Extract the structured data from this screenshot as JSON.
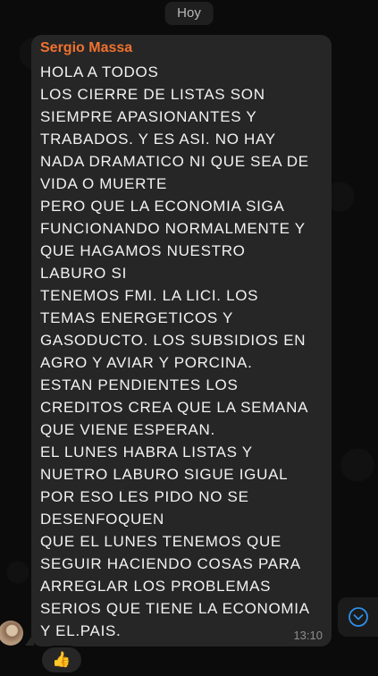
{
  "date_divider": "Hoy",
  "message": {
    "sender": "Sergio Massa",
    "lines": [
      "HOLA A TODOS",
      "LOS CIERRE DE LISTAS SON",
      "SIEMPRE APASIONANTES Y",
      "TRABADOS. Y ES ASI. NO HAY",
      "NADA DRAMATICO NI QUE SEA DE",
      "VIDA O MUERTE",
      "PERO QUE LA ECONOMIA SIGA",
      "FUNCIONANDO NORMALMENTE Y",
      "QUE HAGAMOS NUESTRO",
      "LABURO SI",
      "TENEMOS FMI. LA LICI. LOS",
      "TEMAS ENERGETICOS Y",
      "GASODUCTO. LOS SUBSIDIOS EN",
      "AGRO Y AVIAR Y PORCINA.",
      "ESTAN PENDIENTES LOS",
      "CREDITOS CREA QUE LA SEMANA",
      "QUE VIENE ESPERAN.",
      "EL LUNES HABRA LISTAS Y",
      "NUETRO LABURO SIGUE IGUAL",
      "POR ESO LES PIDO NO SE",
      "DESENFOQUEN",
      "QUE EL LUNES TENEMOS QUE",
      "SEGUIR HACIENDO COSAS PARA",
      "ARREGLAR LOS PROBLEMAS",
      "SERIOS QUE TIENE LA ECONOMIA",
      "Y EL.PAIS."
    ],
    "time": "13:10",
    "reaction": "👍"
  },
  "icons": {
    "scroll_down": "chevron-down-circle-icon",
    "avatar": "sender-avatar"
  },
  "colors": {
    "sender_name": "#f0722f",
    "bubble": "#262626",
    "accent": "#2f8fe8"
  }
}
